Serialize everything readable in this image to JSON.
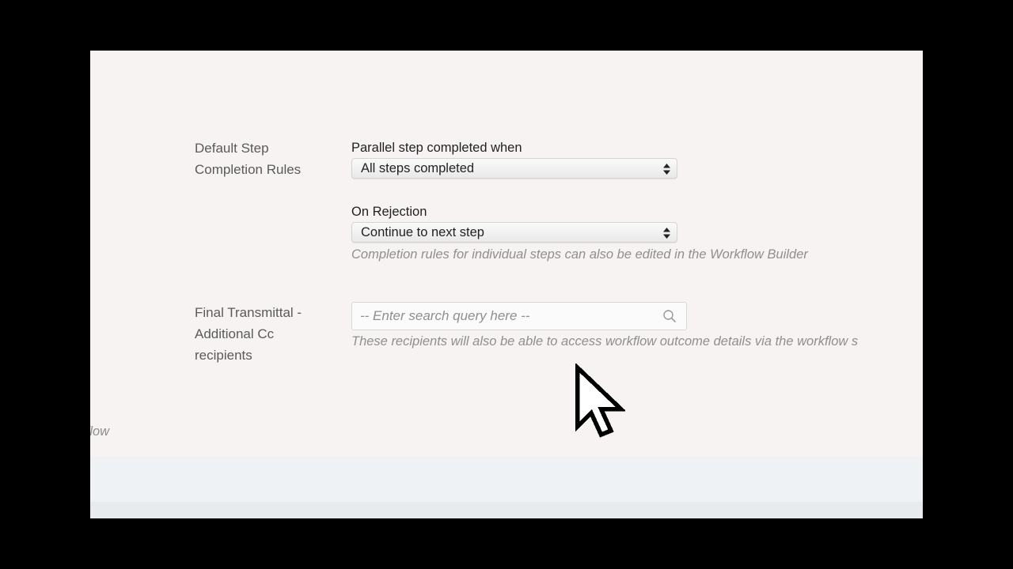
{
  "settings": {
    "default_completion": {
      "label": "Default Step Completion Rules",
      "parallel": {
        "label": "Parallel step completed when",
        "selected": "All steps completed"
      },
      "rejection": {
        "label": "On Rejection",
        "selected": "Continue to next step"
      },
      "hint": "Completion rules for individual steps can also be edited in the Workflow Builder"
    },
    "final_transmittal": {
      "label": "Final Transmittal - Additional Cc recipients",
      "search_placeholder": "-- Enter search query here --",
      "hint": "These recipients will also be able to access workflow outcome details via the workflow s"
    }
  },
  "cut_off_text": "rkflow",
  "icons": {
    "select_arrows": "up-down-arrows-icon",
    "search": "search-icon",
    "cursor": "mouse-pointer-icon"
  },
  "colors": {
    "page_background": "#f6f3f2",
    "footer_background": "#eff2f4",
    "label_text": "#5a5a5a",
    "hint_text": "#8f8f8f",
    "letterbox": "#000000"
  }
}
